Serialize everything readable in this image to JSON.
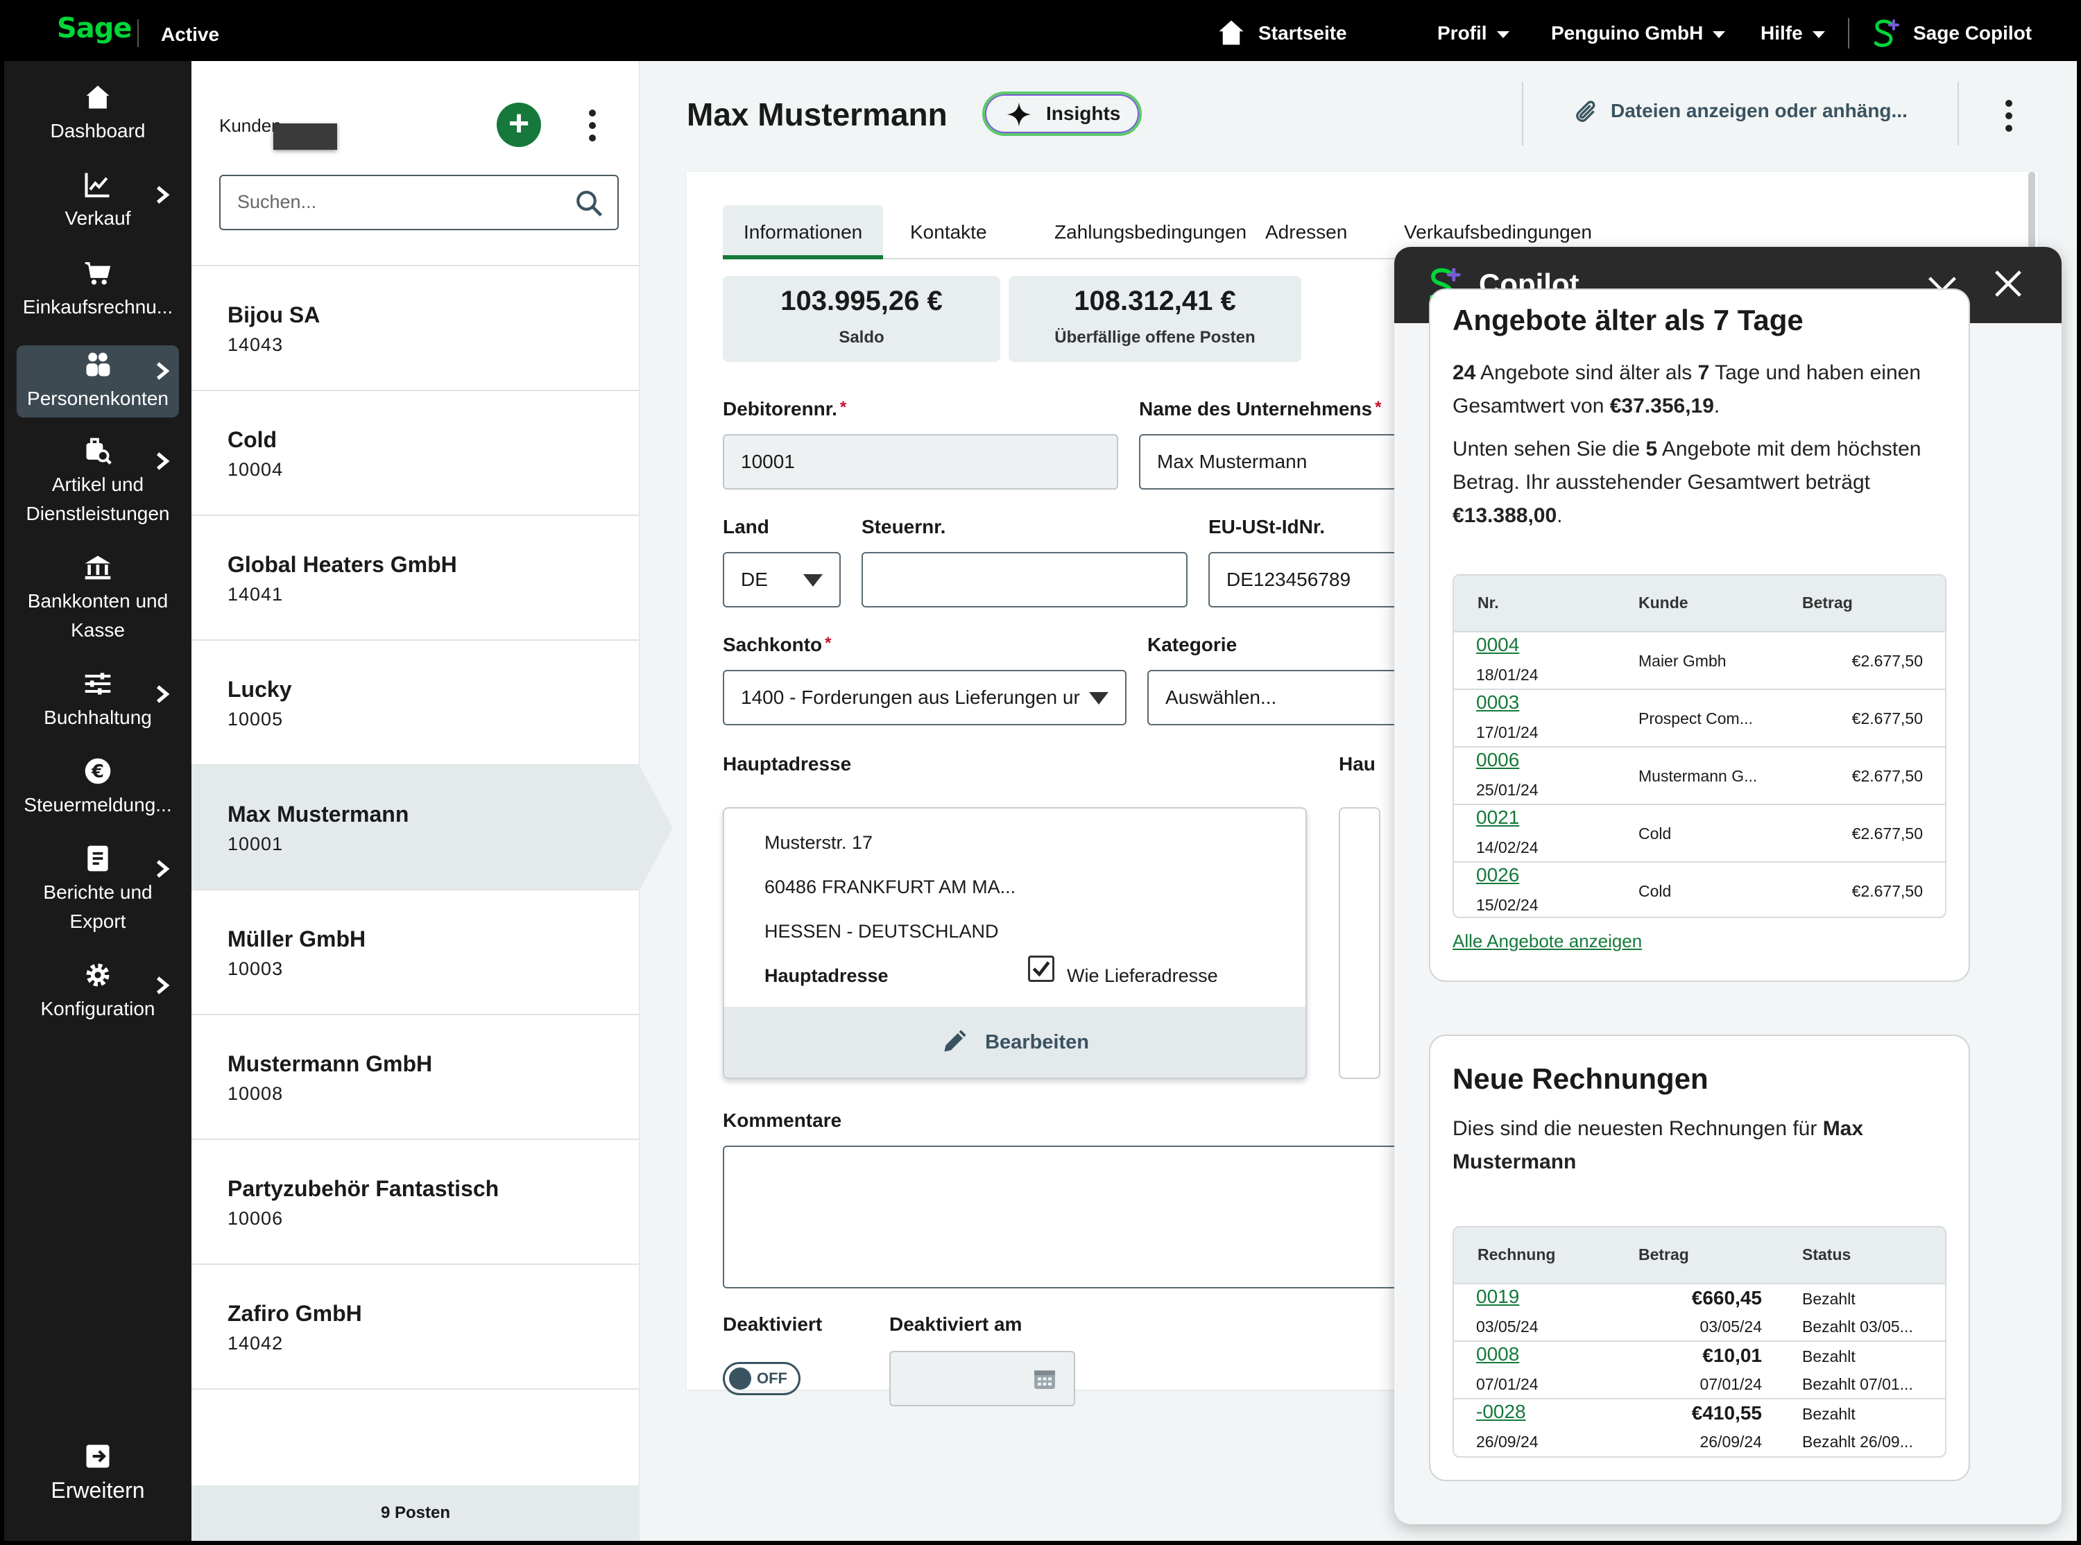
{
  "topbar": {
    "logo": "Sage",
    "status": "Active",
    "nav": {
      "home": "Startseite",
      "profile": "Profil",
      "company": "Penguino GmbH",
      "help": "Hilfe",
      "copilot": "Sage Copilot"
    }
  },
  "sidebar": {
    "items": [
      {
        "label": "Dashboard"
      },
      {
        "label": "Verkauf"
      },
      {
        "label": "Einkaufsrechnu..."
      },
      {
        "label": "Personenkonten"
      },
      {
        "label": "Artikel und Dienstleistungen"
      },
      {
        "label": "Bankkonten und Kasse"
      },
      {
        "label": "Buchhaltung"
      },
      {
        "label": "Steuermeldung..."
      },
      {
        "label": "Berichte und Export"
      },
      {
        "label": "Konfiguration"
      }
    ],
    "expand": "Erweitern"
  },
  "list": {
    "header": "Kunden",
    "search_placeholder": "Suchen...",
    "customers": [
      {
        "name": "Bijou SA",
        "number": "14043"
      },
      {
        "name": "Cold",
        "number": "10004"
      },
      {
        "name": "Global Heaters GmbH",
        "number": "14041"
      },
      {
        "name": "Lucky",
        "number": "10005"
      },
      {
        "name": "Max Mustermann",
        "number": "10001"
      },
      {
        "name": "Müller GmbH",
        "number": "10003"
      },
      {
        "name": "Mustermann GmbH",
        "number": "10008"
      },
      {
        "name": "Partyzubehör Fantastisch",
        "number": "10006"
      },
      {
        "name": "Zafiro GmbH",
        "number": "14042"
      }
    ],
    "footer": "9 Posten"
  },
  "main": {
    "title": "Max Mustermann",
    "insights": "Insights",
    "files": "Dateien anzeigen oder anhäng...",
    "tabs": [
      "Informationen",
      "Kontakte",
      "Zahlungsbedingungen",
      "Adressen",
      "Verkaufsbedingungen"
    ],
    "stats": [
      {
        "value": "103.995,26 €",
        "label": "Saldo"
      },
      {
        "value": "108.312,41 €",
        "label": "Überfällige offene Posten"
      }
    ],
    "fields": {
      "debitor_label": "Debitorennr.",
      "debitor_value": "10001",
      "company_label": "Name des Unternehmens",
      "company_value": "Max Mustermann",
      "country_label": "Land",
      "country_value": "DE",
      "tax_label": "Steuernr.",
      "tax_value": "",
      "vat_label": "EU-USt-IdNr.",
      "vat_value": "DE123456789",
      "account_label": "Sachkonto",
      "account_value": "1400 - Forderungen aus Lieferungen ur",
      "category_label": "Kategorie",
      "category_value": "Auswählen...",
      "req": "*"
    },
    "address": {
      "label": "Hauptadresse",
      "label2": "Hau",
      "line1": "Musterstr. 17",
      "line2": "60486 FRANKFURT AM MA...",
      "line3": "HESSEN - DEUTSCHLAND",
      "type": "Hauptadresse",
      "same_as_delivery": "Wie Lieferadresse",
      "edit": "Bearbeiten"
    },
    "comments_label": "Kommentare",
    "deactivated_label": "Deaktiviert",
    "deactivated_toggle": "OFF",
    "deactivated_on_label": "Deaktiviert am"
  },
  "copilot": {
    "title": "Copilot",
    "quotes": {
      "heading": "Angebote älter als 7 Tage",
      "p1_a": "24",
      "p1_b": " Angebote sind älter als ",
      "p1_c": "7",
      "p1_d": " Tage und haben einen Gesamtwert von ",
      "p1_e": "€37.356,19",
      "p1_f": ".",
      "p2_a": "Unten sehen Sie die ",
      "p2_b": "5",
      "p2_c": " Angebote mit dem höchsten Betrag. Ihr ausstehender Gesamtwert beträgt ",
      "p2_d": "€13.388,00",
      "p2_e": ".",
      "columns": [
        "Nr.",
        "Kunde",
        "Betrag"
      ],
      "rows": [
        {
          "nr": "0004",
          "date": "18/01/24",
          "customer": "Maier Gmbh",
          "amount": "€2.677,50"
        },
        {
          "nr": "0003",
          "date": "17/01/24",
          "customer": "Prospect Com...",
          "amount": "€2.677,50"
        },
        {
          "nr": "0006",
          "date": "25/01/24",
          "customer": "Mustermann G...",
          "amount": "€2.677,50"
        },
        {
          "nr": "0021",
          "date": "14/02/24",
          "customer": "Cold",
          "amount": "€2.677,50"
        },
        {
          "nr": "0026",
          "date": "15/02/24",
          "customer": "Cold",
          "amount": "€2.677,50"
        }
      ],
      "all_link": "Alle Angebote anzeigen"
    },
    "invoices": {
      "heading": "Neue Rechnungen",
      "p_a": "Dies sind die neuesten Rechnungen für ",
      "p_b": "Max Mustermann",
      "columns": [
        "Rechnung",
        "Betrag",
        "Status"
      ],
      "rows": [
        {
          "nr": "0019",
          "date": "03/05/24",
          "amount": "€660,45",
          "date2": "03/05/24",
          "status": "Bezahlt",
          "status2": "Bezahlt 03/05..."
        },
        {
          "nr": "0008",
          "date": "07/01/24",
          "amount": "€10,01",
          "date2": "07/01/24",
          "status": "Bezahlt",
          "status2": "Bezahlt 07/01..."
        },
        {
          "nr": "-0028",
          "date": "26/09/24",
          "amount": "€410,55",
          "date2": "26/09/24",
          "status": "Bezahlt",
          "status2": "Bezahlt 26/09..."
        }
      ]
    }
  },
  "colors": {
    "accent": "#16793b",
    "topbar": "#000000",
    "sidebar": "#1a1a1a",
    "copilot_head": "#2a2a2a"
  }
}
